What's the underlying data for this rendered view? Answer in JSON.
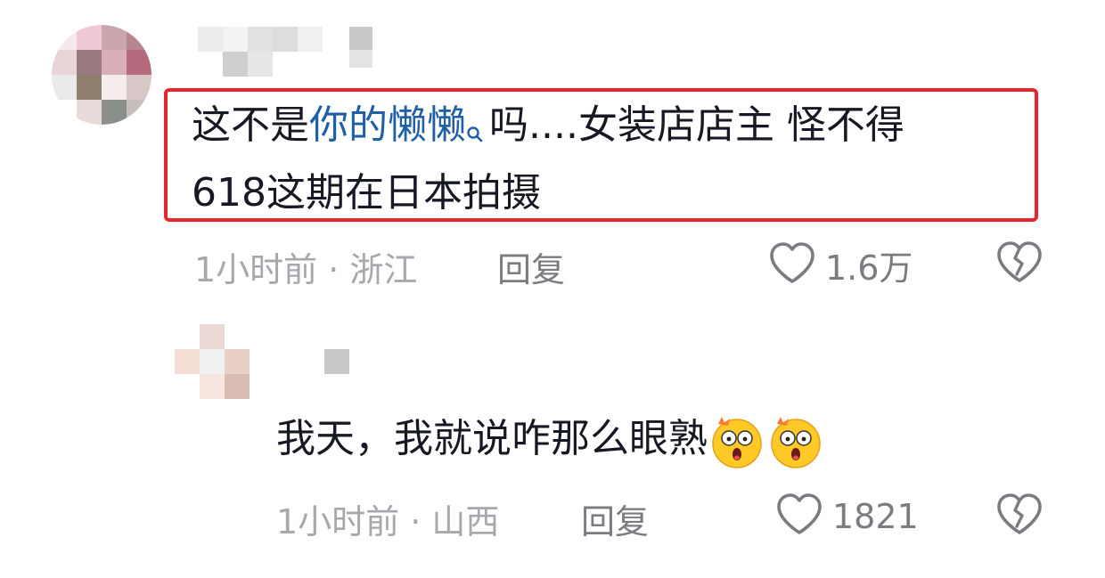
{
  "comments": [
    {
      "text_plain_1": "这不是",
      "text_link": "你的懒懒",
      "text_plain_2": "吗....女装店店主 怪不得",
      "text_line_2": "618这期在日本拍摄",
      "time_location": "1小时前 · 浙江",
      "reply_label": "回复",
      "like_count": "1.6万"
    },
    {
      "text": "我天，我就说咋那么眼熟",
      "emoji": [
        "astonished-face-emoji",
        "astonished-face-emoji"
      ],
      "time_location": "1小时前 · 山西",
      "reply_label": "回复",
      "like_count": "1821"
    }
  ],
  "colors": {
    "highlight_border": "#e8252f",
    "link": "#1f5fa6",
    "meta": "#a7a8ad",
    "action": "#7b7c82"
  },
  "icons": [
    "search-icon",
    "heart-outline-icon",
    "broken-heart-icon"
  ]
}
